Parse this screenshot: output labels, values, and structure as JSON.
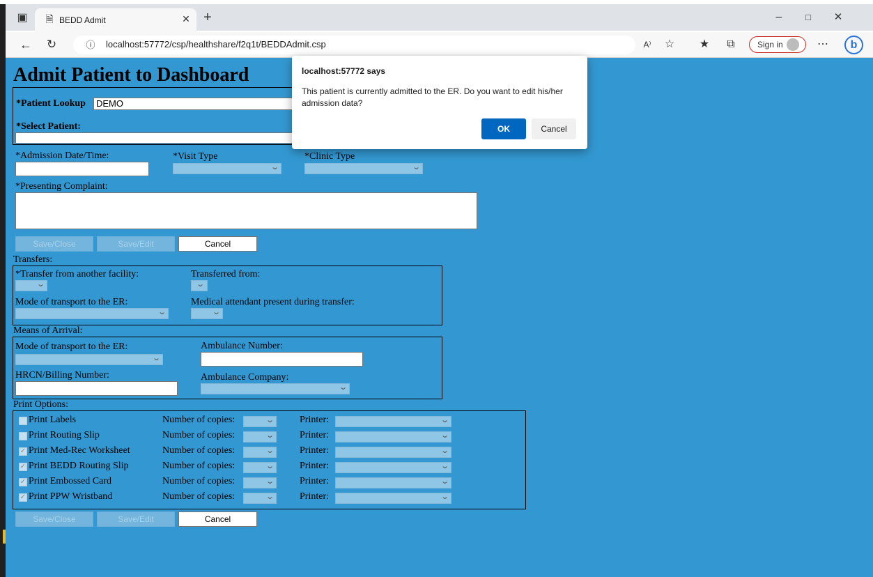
{
  "browser": {
    "tab_title": "BEDD Admit",
    "url": "localhost:57772/csp/healthshare/f2q1t/BEDDAdmit.csp",
    "sign_in_label": "Sign in",
    "icons": [
      "tab-actions-icon",
      "page-icon",
      "close-tab-icon",
      "new-tab-icon",
      "back-icon",
      "refresh-icon",
      "info-icon",
      "read-aloud-icon",
      "add-favorite-icon",
      "favorites-icon",
      "collections-icon",
      "more-icon",
      "bing-icon",
      "minimize-icon",
      "maximize-icon",
      "close-window-icon"
    ]
  },
  "form": {
    "title": "Admit Patient to Dashboard",
    "patient_lookup_label": "*Patient Lookup",
    "patient_lookup_value": "DEMO",
    "select_patient_label": "*Select Patient:",
    "admission_label": "*Admission Date/Time:",
    "visit_type_label": "*Visit Type",
    "clinic_type_label": "*Clinic Type",
    "complaint_label": "*Presenting Complaint:",
    "buttons": {
      "save_close": "Save/Close",
      "save_edit": "Save/Edit",
      "cancel": "Cancel"
    },
    "transfers": {
      "legend": "Transfers:",
      "from_facility_label": "*Transfer from another facility:",
      "transferred_from_label": "Transferred from:",
      "mode_label": "Mode of transport to the ER:",
      "attendant_label": "Medical attendant present during transfer:"
    },
    "arrival": {
      "legend": "Means of Arrival:",
      "mode_label": "Mode of transport to the ER:",
      "ambulance_number_label": "Ambulance Number:",
      "hrcn_label": "HRCN/Billing Number:",
      "ambulance_company_label": "Ambulance Company:"
    },
    "print": {
      "legend": "Print Options:",
      "copies_label": "Number of copies:",
      "printer_label": "Printer:",
      "items": [
        {
          "label": "Print Labels",
          "checked": false
        },
        {
          "label": "Print Routing Slip",
          "checked": false
        },
        {
          "label": "Print Med-Rec Worksheet",
          "checked": true
        },
        {
          "label": "Print BEDD Routing Slip",
          "checked": true
        },
        {
          "label": "Print Embossed Card",
          "checked": true
        },
        {
          "label": "Print PPW Wristband",
          "checked": true
        }
      ]
    }
  },
  "dialog": {
    "title": "localhost:57772 says",
    "message": "This patient is currently admitted to the ER. Do you want to edit his/her admission data?",
    "ok": "OK",
    "cancel": "Cancel"
  },
  "colors": {
    "page_bg": "#3398d1",
    "dialog_ok": "#0067c0",
    "select_bg": "#8fc6e6"
  }
}
